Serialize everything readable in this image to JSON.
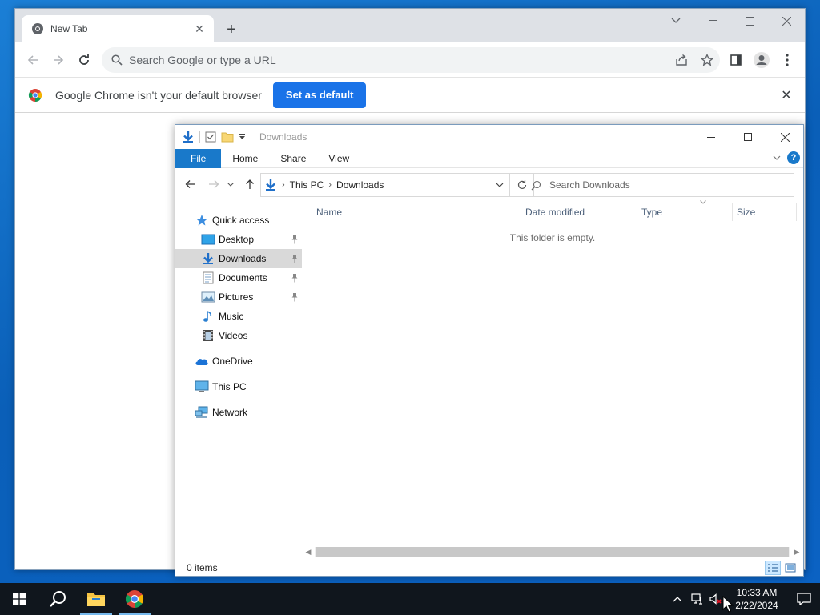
{
  "chrome": {
    "tab_title": "New Tab",
    "omnibox_placeholder": "Search Google or type a URL",
    "infobar_text": "Google Chrome isn't your default browser",
    "infobar_button": "Set as default"
  },
  "explorer": {
    "title": "Downloads",
    "ribbon_tabs": [
      "File",
      "Home",
      "Share",
      "View"
    ],
    "breadcrumb": [
      "This PC",
      "Downloads"
    ],
    "search_placeholder": "Search Downloads",
    "nav": [
      {
        "label": "Quick access",
        "icon": "quick-access-star-icon",
        "pinned": false
      },
      {
        "label": "Desktop",
        "icon": "desktop-folder-icon",
        "pinned": true
      },
      {
        "label": "Downloads",
        "icon": "downloads-arrow-icon",
        "pinned": true,
        "selected": true
      },
      {
        "label": "Documents",
        "icon": "documents-icon",
        "pinned": true
      },
      {
        "label": "Pictures",
        "icon": "pictures-icon",
        "pinned": true
      },
      {
        "label": "Music",
        "icon": "music-note-icon",
        "pinned": false
      },
      {
        "label": "Videos",
        "icon": "videos-film-icon",
        "pinned": false
      },
      {
        "label": "OneDrive",
        "icon": "onedrive-cloud-icon",
        "pinned": false
      },
      {
        "label": "This PC",
        "icon": "this-pc-monitor-icon",
        "pinned": false
      },
      {
        "label": "Network",
        "icon": "network-icon",
        "pinned": false
      }
    ],
    "columns": [
      "Name",
      "Date modified",
      "Type",
      "Size"
    ],
    "empty_message": "This folder is empty.",
    "status_count": "0 items"
  },
  "taskbar": {
    "time": "10:33 AM",
    "date": "2/22/2024"
  },
  "colors": {
    "chrome_blue": "#1a73e8",
    "explorer_file_tab": "#1979ca",
    "taskbar": "#10161d",
    "desktop": "#0a5fb8"
  }
}
